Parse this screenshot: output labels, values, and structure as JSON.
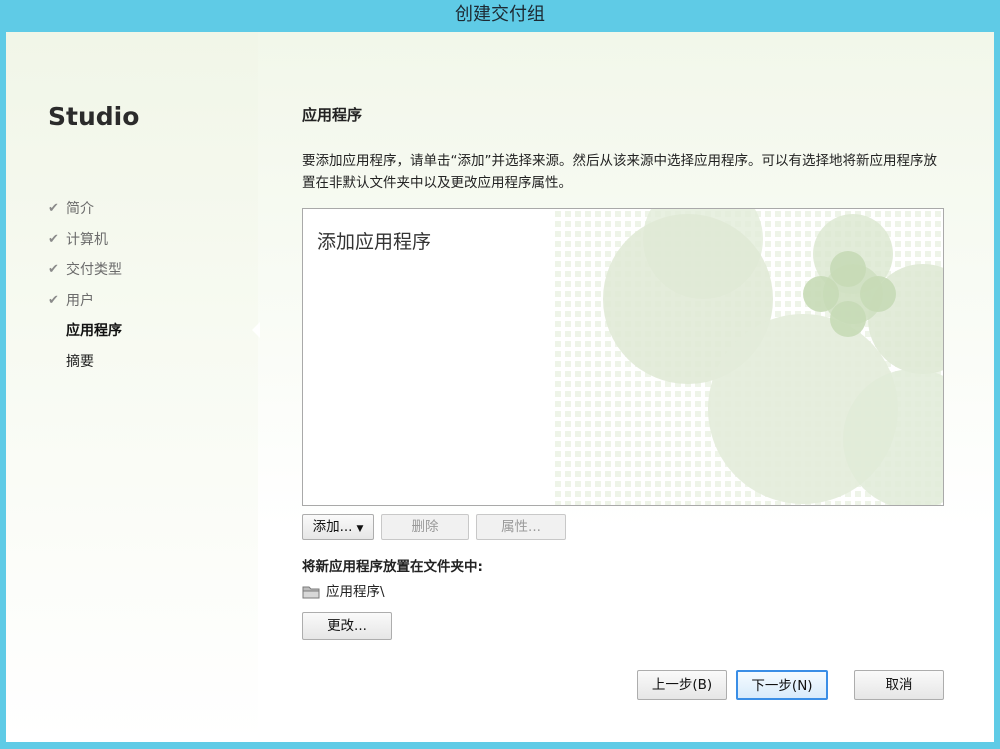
{
  "window": {
    "title": "创建交付组"
  },
  "sidebar": {
    "product_title": "Studio",
    "steps": [
      {
        "label": "简介",
        "state": "done"
      },
      {
        "label": "计算机",
        "state": "done"
      },
      {
        "label": "交付类型",
        "state": "done"
      },
      {
        "label": "用户",
        "state": "done"
      },
      {
        "label": "应用程序",
        "state": "active"
      },
      {
        "label": "摘要",
        "state": "pending"
      }
    ],
    "check_glyph": "✔"
  },
  "main": {
    "section_title": "应用程序",
    "description": "要添加应用程序，请单击“添加”并选择来源。然后从该来源中选择应用程序。可以有选择地将新应用程序放置在非默认文件夹中以及更改应用程序属性。",
    "app_list": {
      "placeholder": "添加应用程序"
    },
    "buttons": {
      "add": "添加...",
      "delete": "删除",
      "properties": "属性..."
    },
    "folder": {
      "label": "将新应用程序放置在文件夹中:",
      "path": "应用程序\\",
      "icon": "folder-icon",
      "change_button": "更改..."
    }
  },
  "footer": {
    "back": "上一步(B)",
    "next": "下一步(N)",
    "cancel": "取消"
  },
  "colors": {
    "frame": "#5fcbe6",
    "accent_focus": "#3a8ee6",
    "watermark": "#d5e4c8"
  }
}
